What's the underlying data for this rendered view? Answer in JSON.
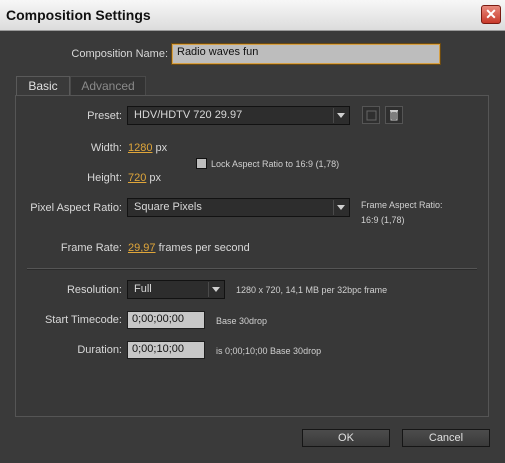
{
  "window": {
    "title": "Composition Settings"
  },
  "composition_name": {
    "label": "Composition Name:",
    "value": "Radio waves fun"
  },
  "tabs": [
    {
      "label": "Basic"
    },
    {
      "label": "Advanced"
    }
  ],
  "basic": {
    "preset": {
      "label": "Preset:",
      "value": "HDV/HDTV 720 29.97"
    },
    "width": {
      "label": "Width:",
      "value": "1280",
      "unit": "px"
    },
    "height": {
      "label": "Height:",
      "value": "720",
      "unit": "px"
    },
    "lock_aspect": {
      "label": "Lock Aspect Ratio to 16:9 (1,78)",
      "checked": false
    },
    "pixel_aspect": {
      "label": "Pixel Aspect Ratio:",
      "value": "Square Pixels"
    },
    "frame_aspect": {
      "label": "Frame Aspect Ratio:",
      "value": "16:9 (1,78)"
    },
    "frame_rate": {
      "label": "Frame Rate:",
      "value": "29,97",
      "unit": "frames per second"
    },
    "resolution": {
      "label": "Resolution:",
      "value": "Full",
      "info": "1280 x 720, 14,1 MB per 32bpc frame"
    },
    "start_timecode": {
      "label": "Start Timecode:",
      "value": "0;00;00;00",
      "info": "Base 30drop"
    },
    "duration": {
      "label": "Duration:",
      "value": "0;00;10;00",
      "info": "is 0;00;10;00  Base 30drop"
    }
  },
  "buttons": {
    "ok": "OK",
    "cancel": "Cancel"
  },
  "colors": {
    "accent_value": "#e0a63a",
    "background": "#3a3a3a"
  }
}
